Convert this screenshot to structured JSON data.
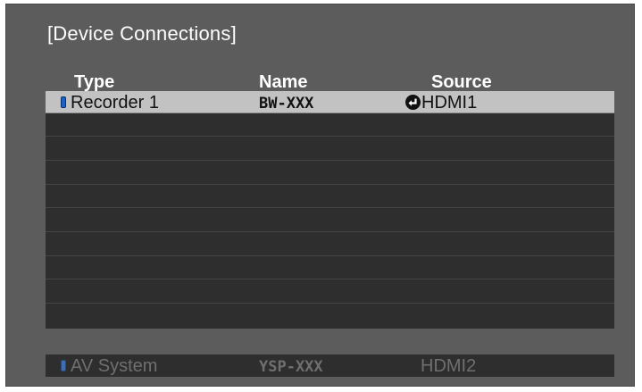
{
  "dialog": {
    "title": "[Device Connections]"
  },
  "columns": {
    "type": "Type",
    "name": "Name",
    "source": "Source"
  },
  "connected_devices": [
    {
      "type": "Recorder 1",
      "name": "BW-XXX",
      "source": "HDMI1",
      "selected": true,
      "linked": true
    }
  ],
  "other_device": {
    "type": "AV System",
    "name": "YSP-XXX",
    "source": "HDMI2"
  },
  "colors": {
    "background": "#5c5c5c",
    "list_background": "#2e2e2e",
    "selection": "#c2c2c2",
    "device_icon": "#1c63c8",
    "disabled_text": "#6f6f6f"
  },
  "icons": {
    "device": "device-icon",
    "link": "link-arrow-icon"
  }
}
